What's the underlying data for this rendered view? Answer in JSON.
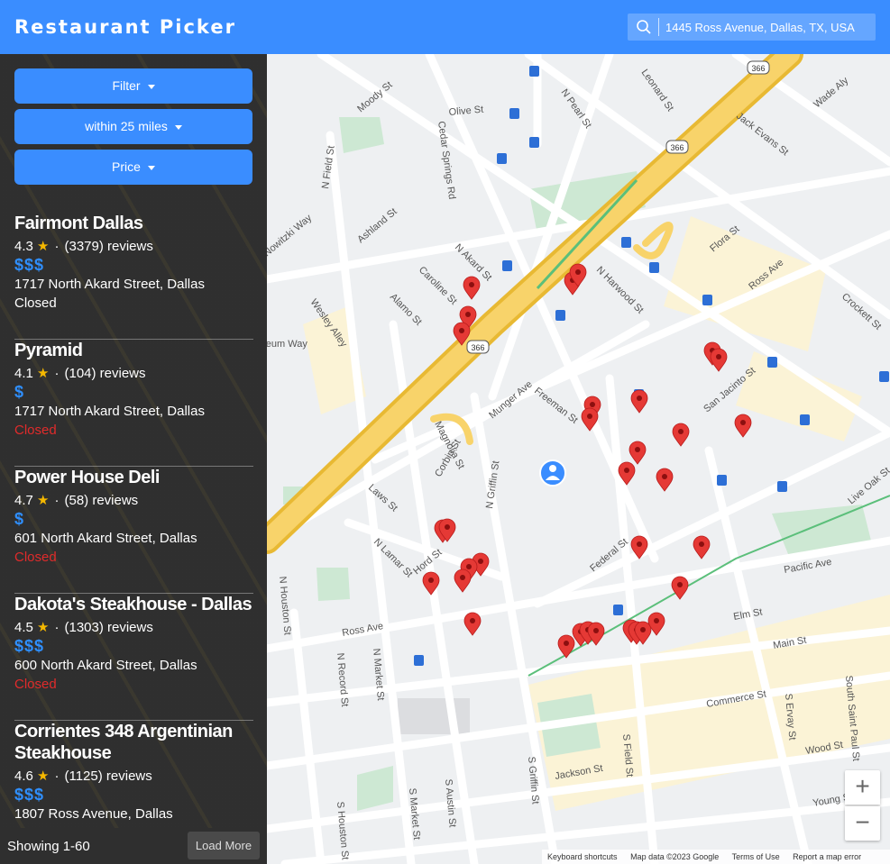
{
  "header": {
    "title": "Restaurant Picker",
    "search_value": "1445 Ross Avenue, Dallas, TX, USA"
  },
  "sidebar": {
    "filter_label": "Filter",
    "distance_label": "within 25 miles",
    "price_label": "Price",
    "results": [
      {
        "name": "Fairmont Dallas",
        "rating": "4.3",
        "reviews": "(3379) reviews",
        "price": "$$$",
        "address": "1717 North Akard Street, Dallas",
        "status": "Closed"
      },
      {
        "name": "Pyramid",
        "rating": "4.1",
        "reviews": "(104) reviews",
        "price": "$",
        "address": "1717 North Akard Street, Dallas",
        "status": "Closed"
      },
      {
        "name": "Power House Deli",
        "rating": "4.7",
        "reviews": "(58) reviews",
        "price": "$",
        "address": "601 North Akard Street, Dallas",
        "status": "Closed"
      },
      {
        "name": "Dakota's Steakhouse - Dallas",
        "rating": "4.5",
        "reviews": "(1303) reviews",
        "price": "$$$",
        "address": "600 North Akard Street, Dallas",
        "status": "Closed"
      },
      {
        "name": "Corrientes 348 Argentinian Steakhouse",
        "rating": "4.6",
        "reviews": "(1125) reviews",
        "price": "$$$",
        "address": "1807 Ross Avenue, Dallas",
        "status": ""
      }
    ],
    "showing": "Showing 1-60",
    "load_more": "Load More"
  },
  "map": {
    "zoom_in": "+",
    "zoom_out": "−",
    "attribution": {
      "shortcuts": "Keyboard shortcuts",
      "data": "Map data ©2023 Google",
      "terms": "Terms of Use",
      "report": "Report a map error"
    },
    "street_labels": [
      "Moody St",
      "Olive St",
      "N Pearl St",
      "Leonard St",
      "Wade Aly",
      "Jack Evans St",
      "Cedar Springs Rd",
      "N Field St",
      "Ashland St",
      "Nowitzki Way",
      "N Akard St",
      "Caroline St",
      "Alamo St",
      "Wesley Alley",
      "N Harwood St",
      "Flora St",
      "Ross Ave",
      "Crockett St",
      "Munger Ave",
      "Freeman St",
      "San Jacinto St",
      "Magnolia St",
      "N Griffin St",
      "Laws St",
      "Corbin St",
      "Hord St",
      "N Lamar St",
      "Federal St",
      "Pacific Ave",
      "Elm St",
      "Main St",
      "Commerce St",
      "Jackson St",
      "Wood St",
      "Young St",
      "S Griffin St",
      "S Field St",
      "S Ervay St",
      "South Saint Paul St",
      "N Houston St",
      "N Record St",
      "N Market St",
      "S Houston St",
      "S Market St",
      "S Austin St",
      "Live Oak St",
      "Museum Way",
      "Ross Ave"
    ],
    "highway_shield": "366"
  },
  "colors": {
    "header": "#3a8dff",
    "button": "#3a8dff",
    "price": "#2f8fff",
    "closed_red": "#e02b2b",
    "marker": "#e53935",
    "highway": "#f5c542"
  }
}
